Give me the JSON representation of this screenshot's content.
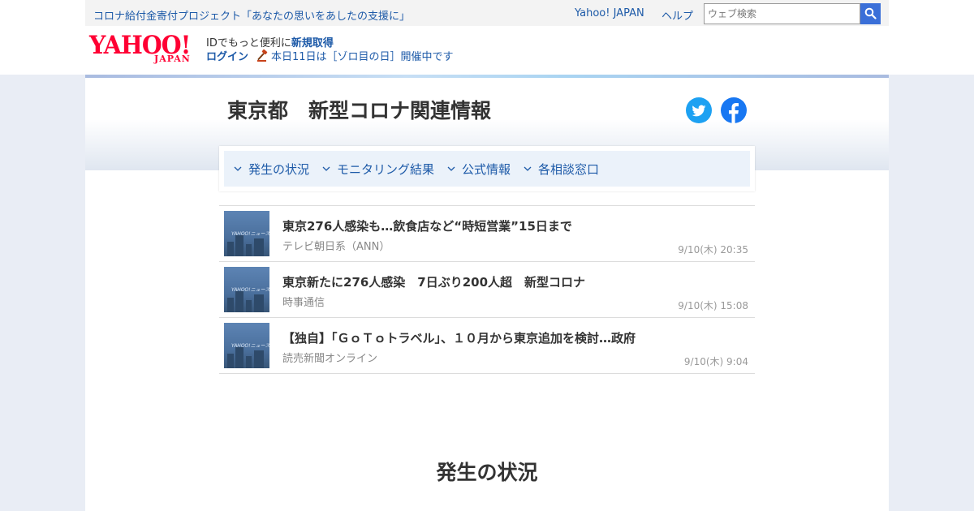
{
  "topbar": {
    "promo_link": "コロナ給付金寄付プロジェクト「あなたの思いをあしたの支援に」",
    "yahoo_japan_link": "Yahoo! JAPAN",
    "help_link": "ヘルプ",
    "search_placeholder": "ウェブ検索",
    "search_icon": "magnifier-icon"
  },
  "header": {
    "logo_text": "YAHOO!",
    "logo_sub": "JAPAN",
    "id_text": "IDでもっと便利に",
    "signup_link": "新規取得",
    "login_link": "ログイン",
    "zorome_text": "本日11日は［ゾロ目の日］開催中です",
    "zorome_icon": "gavel-icon"
  },
  "page": {
    "title": "東京都　新型コロナ関連情報",
    "share_icons": [
      "twitter-icon",
      "facebook-icon"
    ]
  },
  "nav": {
    "items": [
      {
        "label": "発生の状況"
      },
      {
        "label": "モニタリング結果"
      },
      {
        "label": "公式情報"
      },
      {
        "label": "各相談窓口"
      }
    ]
  },
  "news": {
    "items": [
      {
        "title": "東京276人感染も…飲食店など“時短営業”15日まで",
        "source": "テレビ朝日系（ANN）",
        "time": "9/10(木) 20:35",
        "thumb_label": "YAHOO!ニュース"
      },
      {
        "title": "東京新たに276人感染　7日ぶり200人超　新型コロナ",
        "source": "時事通信",
        "time": "9/10(木) 15:08",
        "thumb_label": "YAHOO!ニュース"
      },
      {
        "title": "【独自】「ＧｏＴｏトラベル」、１０月から東京追加を検討…政府",
        "source": "読売新聞オンライン",
        "time": "9/10(木) 9:04",
        "thumb_label": "YAHOO!ニュース"
      }
    ]
  },
  "section": {
    "title": "発生の状況"
  },
  "colors": {
    "link": "#1d5aa8",
    "brand_red": "#ff0033",
    "search_button": "#3a6fd8",
    "twitter": "#1da1f2",
    "facebook": "#1877f2"
  }
}
